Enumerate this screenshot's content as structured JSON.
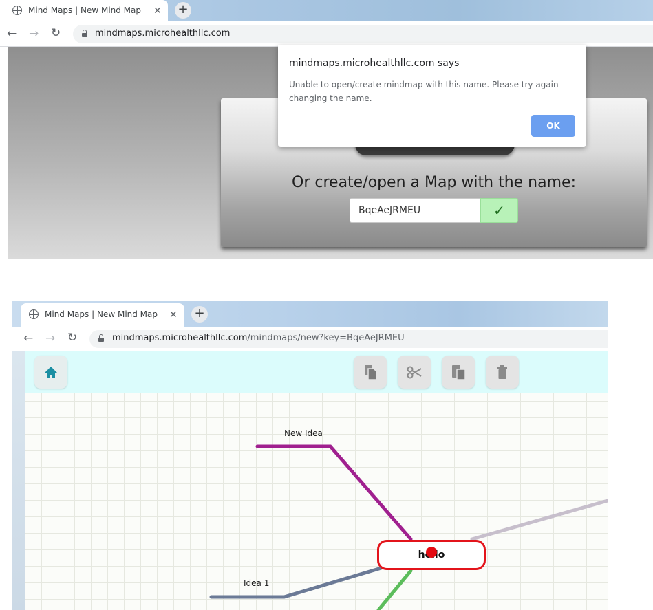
{
  "top_window": {
    "tab_title": "Mind Maps | New Mind Map",
    "tab_close": "✕",
    "new_tab": "+",
    "url_host": "mindmaps.microhealthllc.com",
    "create_label": "Or create/open a Map with the name:",
    "map_name_value": "BqeAeJRMEU",
    "dialog": {
      "title": "mindmaps.microhealthllc.com says",
      "message": "Unable to open/create mindmap with this name. Please try again changing the name.",
      "ok_label": "OK"
    }
  },
  "bottom_window": {
    "tab_title": "Mind Maps | New Mind Map",
    "tab_close": "✕",
    "new_tab": "+",
    "url_host": "mindmaps.microhealthllc.com",
    "url_path": "/mindmaps/new?key=BqeAeJRMEU",
    "toolbar": {
      "home_icon": "home-icon",
      "copy_icon": "copy-icon",
      "cut_icon": "scissors-icon",
      "paste_icon": "paste-icon",
      "delete_icon": "trash-icon"
    },
    "mindmap": {
      "root_label": "hello",
      "nodes": [
        "New Idea",
        "Idea 1"
      ],
      "colors": {
        "root_border": "#e3141b",
        "new_idea_branch": "#a0208f",
        "idea1_branch": "#6b7a96",
        "green_branch": "#5cbd5c",
        "right_branch": "#c7bfcc"
      }
    }
  }
}
